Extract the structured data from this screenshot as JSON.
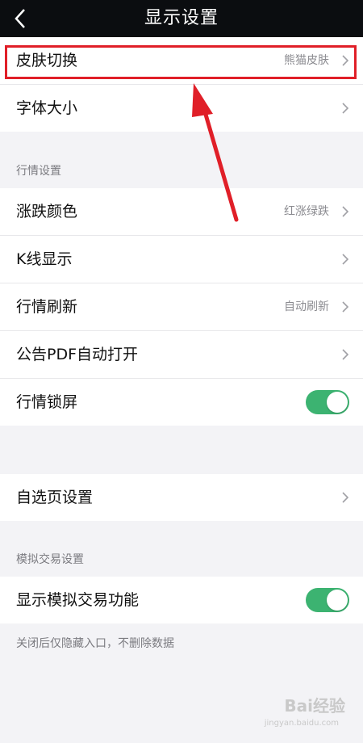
{
  "header": {
    "title": "显示设置"
  },
  "group1": [
    {
      "label": "皮肤切换",
      "value": "熊猫皮肤"
    },
    {
      "label": "字体大小",
      "value": ""
    }
  ],
  "section_market": {
    "label": "行情设置"
  },
  "group2": [
    {
      "label": "涨跌颜色",
      "value": "红涨绿跌"
    },
    {
      "label": "K线显示",
      "value": ""
    },
    {
      "label": "行情刷新",
      "value": "自动刷新"
    },
    {
      "label": "公告PDF自动打开",
      "value": ""
    },
    {
      "label": "行情锁屏",
      "toggle": true
    }
  ],
  "group3": [
    {
      "label": "自选页设置",
      "value": ""
    }
  ],
  "section_sim": {
    "label": "模拟交易设置"
  },
  "group4": [
    {
      "label": "显示模拟交易功能",
      "toggle": true
    }
  ],
  "note": "关闭后仅隐藏入口，不删除数据",
  "watermark": {
    "brand": "Bai",
    "brand_cn": "经验",
    "url": "jingyan.baidu.com"
  },
  "colors": {
    "toggle_on": "#3cb371",
    "annotation": "#e01f28"
  }
}
